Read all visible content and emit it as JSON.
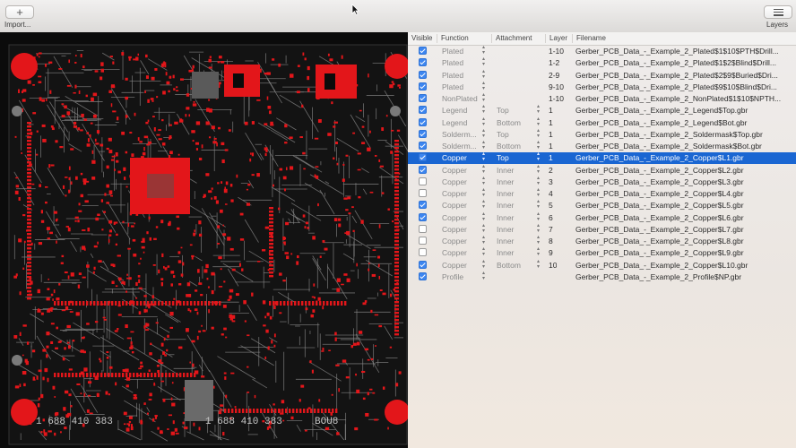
{
  "toolbar": {
    "import_label": "Import...",
    "layers_label": "Layers",
    "import_glyph": "+"
  },
  "table": {
    "headers": [
      "Visible",
      "Function",
      "Attachment",
      "Layer",
      "Filename"
    ],
    "rows": [
      {
        "visible": true,
        "function": "Plated",
        "attachment": "",
        "layer": "1-10",
        "filename": "Gerber_PCB_Data_-_Example_2_Plated$1$10$PTH$Drill..."
      },
      {
        "visible": true,
        "function": "Plated",
        "attachment": "",
        "layer": "1-2",
        "filename": "Gerber_PCB_Data_-_Example_2_Plated$1$2$Blind$Drill..."
      },
      {
        "visible": true,
        "function": "Plated",
        "attachment": "",
        "layer": "2-9",
        "filename": "Gerber_PCB_Data_-_Example_2_Plated$2$9$Buried$Dri..."
      },
      {
        "visible": true,
        "function": "Plated",
        "attachment": "",
        "layer": "9-10",
        "filename": "Gerber_PCB_Data_-_Example_2_Plated$9$10$Blind$Dri..."
      },
      {
        "visible": true,
        "function": "NonPlated",
        "attachment": "",
        "layer": "1-10",
        "filename": "Gerber_PCB_Data_-_Example_2_NonPlated$1$10$NPTH..."
      },
      {
        "visible": true,
        "function": "Legend",
        "attachment": "Top",
        "layer": "1",
        "filename": "Gerber_PCB_Data_-_Example_2_Legend$Top.gbr"
      },
      {
        "visible": true,
        "function": "Legend",
        "attachment": "Bottom",
        "layer": "1",
        "filename": "Gerber_PCB_Data_-_Example_2_Legend$Bot.gbr"
      },
      {
        "visible": true,
        "function": "Solderm...",
        "attachment": "Top",
        "layer": "1",
        "filename": "Gerber_PCB_Data_-_Example_2_Soldermask$Top.gbr"
      },
      {
        "visible": true,
        "function": "Solderm...",
        "attachment": "Bottom",
        "layer": "1",
        "filename": "Gerber_PCB_Data_-_Example_2_Soldermask$Bot.gbr"
      },
      {
        "visible": true,
        "function": "Copper",
        "attachment": "Top",
        "layer": "1",
        "filename": "Gerber_PCB_Data_-_Example_2_Copper$L1.gbr",
        "selected": true
      },
      {
        "visible": true,
        "function": "Copper",
        "attachment": "Inner",
        "layer": "2",
        "filename": "Gerber_PCB_Data_-_Example_2_Copper$L2.gbr"
      },
      {
        "visible": false,
        "function": "Copper",
        "attachment": "Inner",
        "layer": "3",
        "filename": "Gerber_PCB_Data_-_Example_2_Copper$L3.gbr"
      },
      {
        "visible": false,
        "function": "Copper",
        "attachment": "Inner",
        "layer": "4",
        "filename": "Gerber_PCB_Data_-_Example_2_Copper$L4.gbr"
      },
      {
        "visible": true,
        "function": "Copper",
        "attachment": "Inner",
        "layer": "5",
        "filename": "Gerber_PCB_Data_-_Example_2_Copper$L5.gbr"
      },
      {
        "visible": true,
        "function": "Copper",
        "attachment": "Inner",
        "layer": "6",
        "filename": "Gerber_PCB_Data_-_Example_2_Copper$L6.gbr"
      },
      {
        "visible": false,
        "function": "Copper",
        "attachment": "Inner",
        "layer": "7",
        "filename": "Gerber_PCB_Data_-_Example_2_Copper$L7.gbr"
      },
      {
        "visible": false,
        "function": "Copper",
        "attachment": "Inner",
        "layer": "8",
        "filename": "Gerber_PCB_Data_-_Example_2_Copper$L8.gbr"
      },
      {
        "visible": false,
        "function": "Copper",
        "attachment": "Inner",
        "layer": "9",
        "filename": "Gerber_PCB_Data_-_Example_2_Copper$L9.gbr"
      },
      {
        "visible": true,
        "function": "Copper",
        "attachment": "Bottom",
        "layer": "10",
        "filename": "Gerber_PCB_Data_-_Example_2_Copper$L10.gbr"
      },
      {
        "visible": true,
        "function": "Profile",
        "attachment": "",
        "layer": "",
        "filename": "Gerber_PCB_Data_-_Example_2_Profile$NP.gbr"
      }
    ]
  },
  "pcb": {
    "silk_left": "1 688 410 383",
    "silk_right": "1 688 410 383",
    "silk_tag": "BOU8",
    "colors": {
      "copper": "#e3161a",
      "trace": "#8b8b8b",
      "board": "#0b0b0b"
    }
  }
}
